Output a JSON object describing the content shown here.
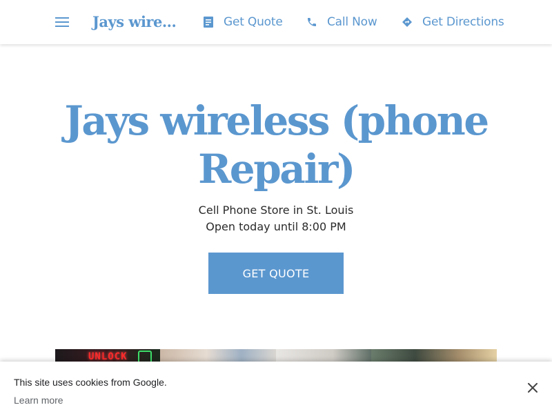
{
  "nav": {
    "menu_icon": "hamburger-menu-icon",
    "brand": "Jays wire...",
    "links": [
      {
        "label": "Get Quote",
        "icon": "document-icon"
      },
      {
        "label": "Call Now",
        "icon": "phone-icon"
      },
      {
        "label": "Get Directions",
        "icon": "directions-icon"
      }
    ],
    "accent_color": "#5b97cf"
  },
  "hero": {
    "title": "Jays wireless (phone Repair)",
    "category_line": "Cell Phone Store in St. Louis",
    "hours_line": "Open today until 8:00 PM",
    "cta_label": "GET QUOTE"
  },
  "photo_strip": {
    "neon_sign_text": "UNLOCK"
  },
  "cookie_banner": {
    "message": "This site uses cookies from Google.",
    "link": "Learn more",
    "close_icon": "close-icon"
  }
}
